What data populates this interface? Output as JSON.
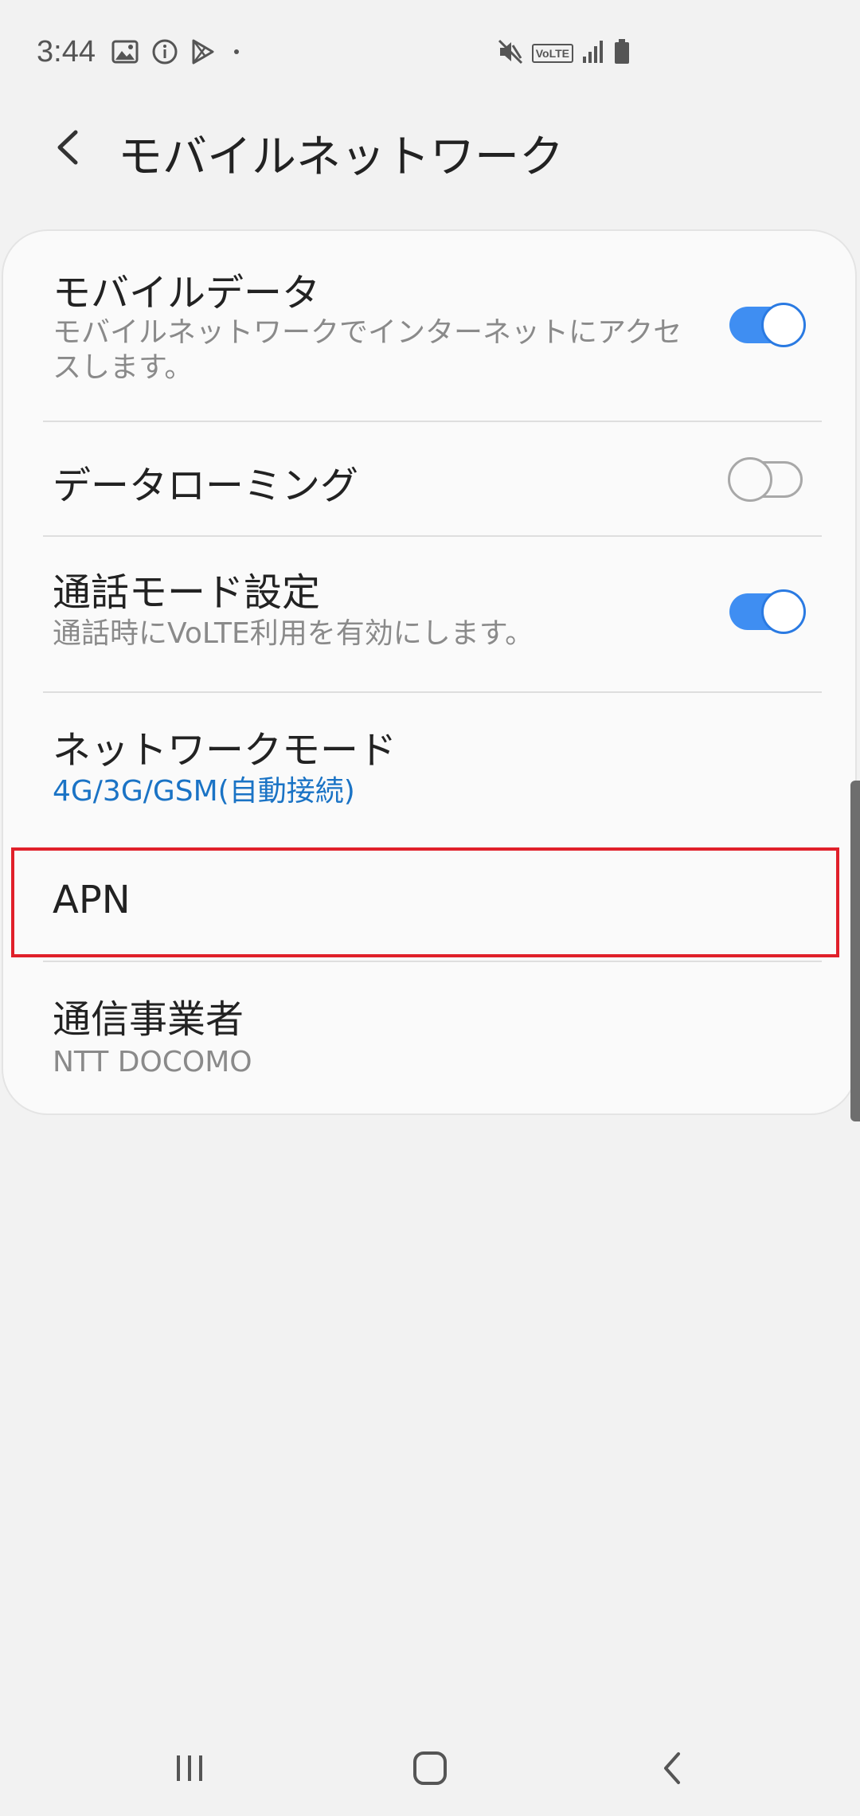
{
  "status_bar": {
    "time": "3:44",
    "left_icons": [
      "image-icon",
      "info-icon",
      "play-store-icon",
      "dot-icon"
    ],
    "right_icons": [
      "vibrate-mute-icon",
      "volte-icon",
      "signal-icon",
      "battery-icon"
    ],
    "volte_label": "VoLTE"
  },
  "header": {
    "title": "モバイルネットワーク"
  },
  "settings": {
    "mobile_data": {
      "title": "モバイルデータ",
      "subtitle_line1": "モバイルネットワークでインターネットにアクセ",
      "subtitle_line2": "スします。",
      "enabled": true
    },
    "data_roaming": {
      "title": "データローミング",
      "enabled": false
    },
    "call_mode": {
      "title": "通話モード設定",
      "subtitle": "通話時にVoLTE利用を有効にします。",
      "enabled": true
    },
    "network_mode": {
      "title": "ネットワークモード",
      "value": "4G/3G/GSM(自動接続)"
    },
    "apn": {
      "title": "APN"
    },
    "carrier": {
      "title": "通信事業者",
      "value": "NTT DOCOMO"
    }
  },
  "colors": {
    "accent_blue": "#3f8ef2",
    "link_blue": "#1a73c5",
    "highlight_red": "#e0202a",
    "background": "#f2f2f2"
  },
  "nav_bar": {
    "buttons": [
      "recents-icon",
      "home-icon",
      "back-icon"
    ]
  }
}
